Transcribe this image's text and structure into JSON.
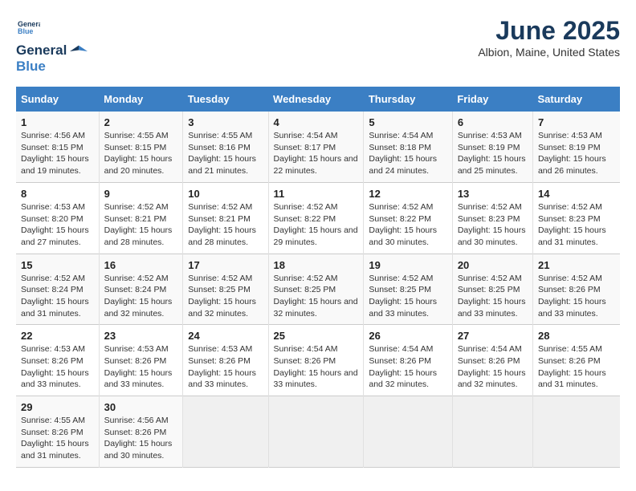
{
  "logo": {
    "line1": "General",
    "line2": "Blue"
  },
  "title": "June 2025",
  "location": "Albion, Maine, United States",
  "days_of_week": [
    "Sunday",
    "Monday",
    "Tuesday",
    "Wednesday",
    "Thursday",
    "Friday",
    "Saturday"
  ],
  "weeks": [
    [
      {
        "day": "1",
        "sunrise": "Sunrise: 4:56 AM",
        "sunset": "Sunset: 8:15 PM",
        "daylight": "Daylight: 15 hours and 19 minutes."
      },
      {
        "day": "2",
        "sunrise": "Sunrise: 4:55 AM",
        "sunset": "Sunset: 8:15 PM",
        "daylight": "Daylight: 15 hours and 20 minutes."
      },
      {
        "day": "3",
        "sunrise": "Sunrise: 4:55 AM",
        "sunset": "Sunset: 8:16 PM",
        "daylight": "Daylight: 15 hours and 21 minutes."
      },
      {
        "day": "4",
        "sunrise": "Sunrise: 4:54 AM",
        "sunset": "Sunset: 8:17 PM",
        "daylight": "Daylight: 15 hours and 22 minutes."
      },
      {
        "day": "5",
        "sunrise": "Sunrise: 4:54 AM",
        "sunset": "Sunset: 8:18 PM",
        "daylight": "Daylight: 15 hours and 24 minutes."
      },
      {
        "day": "6",
        "sunrise": "Sunrise: 4:53 AM",
        "sunset": "Sunset: 8:19 PM",
        "daylight": "Daylight: 15 hours and 25 minutes."
      },
      {
        "day": "7",
        "sunrise": "Sunrise: 4:53 AM",
        "sunset": "Sunset: 8:19 PM",
        "daylight": "Daylight: 15 hours and 26 minutes."
      }
    ],
    [
      {
        "day": "8",
        "sunrise": "Sunrise: 4:53 AM",
        "sunset": "Sunset: 8:20 PM",
        "daylight": "Daylight: 15 hours and 27 minutes."
      },
      {
        "day": "9",
        "sunrise": "Sunrise: 4:52 AM",
        "sunset": "Sunset: 8:21 PM",
        "daylight": "Daylight: 15 hours and 28 minutes."
      },
      {
        "day": "10",
        "sunrise": "Sunrise: 4:52 AM",
        "sunset": "Sunset: 8:21 PM",
        "daylight": "Daylight: 15 hours and 28 minutes."
      },
      {
        "day": "11",
        "sunrise": "Sunrise: 4:52 AM",
        "sunset": "Sunset: 8:22 PM",
        "daylight": "Daylight: 15 hours and 29 minutes."
      },
      {
        "day": "12",
        "sunrise": "Sunrise: 4:52 AM",
        "sunset": "Sunset: 8:22 PM",
        "daylight": "Daylight: 15 hours and 30 minutes."
      },
      {
        "day": "13",
        "sunrise": "Sunrise: 4:52 AM",
        "sunset": "Sunset: 8:23 PM",
        "daylight": "Daylight: 15 hours and 30 minutes."
      },
      {
        "day": "14",
        "sunrise": "Sunrise: 4:52 AM",
        "sunset": "Sunset: 8:23 PM",
        "daylight": "Daylight: 15 hours and 31 minutes."
      }
    ],
    [
      {
        "day": "15",
        "sunrise": "Sunrise: 4:52 AM",
        "sunset": "Sunset: 8:24 PM",
        "daylight": "Daylight: 15 hours and 31 minutes."
      },
      {
        "day": "16",
        "sunrise": "Sunrise: 4:52 AM",
        "sunset": "Sunset: 8:24 PM",
        "daylight": "Daylight: 15 hours and 32 minutes."
      },
      {
        "day": "17",
        "sunrise": "Sunrise: 4:52 AM",
        "sunset": "Sunset: 8:25 PM",
        "daylight": "Daylight: 15 hours and 32 minutes."
      },
      {
        "day": "18",
        "sunrise": "Sunrise: 4:52 AM",
        "sunset": "Sunset: 8:25 PM",
        "daylight": "Daylight: 15 hours and 32 minutes."
      },
      {
        "day": "19",
        "sunrise": "Sunrise: 4:52 AM",
        "sunset": "Sunset: 8:25 PM",
        "daylight": "Daylight: 15 hours and 33 minutes."
      },
      {
        "day": "20",
        "sunrise": "Sunrise: 4:52 AM",
        "sunset": "Sunset: 8:25 PM",
        "daylight": "Daylight: 15 hours and 33 minutes."
      },
      {
        "day": "21",
        "sunrise": "Sunrise: 4:52 AM",
        "sunset": "Sunset: 8:26 PM",
        "daylight": "Daylight: 15 hours and 33 minutes."
      }
    ],
    [
      {
        "day": "22",
        "sunrise": "Sunrise: 4:53 AM",
        "sunset": "Sunset: 8:26 PM",
        "daylight": "Daylight: 15 hours and 33 minutes."
      },
      {
        "day": "23",
        "sunrise": "Sunrise: 4:53 AM",
        "sunset": "Sunset: 8:26 PM",
        "daylight": "Daylight: 15 hours and 33 minutes."
      },
      {
        "day": "24",
        "sunrise": "Sunrise: 4:53 AM",
        "sunset": "Sunset: 8:26 PM",
        "daylight": "Daylight: 15 hours and 33 minutes."
      },
      {
        "day": "25",
        "sunrise": "Sunrise: 4:54 AM",
        "sunset": "Sunset: 8:26 PM",
        "daylight": "Daylight: 15 hours and 33 minutes."
      },
      {
        "day": "26",
        "sunrise": "Sunrise: 4:54 AM",
        "sunset": "Sunset: 8:26 PM",
        "daylight": "Daylight: 15 hours and 32 minutes."
      },
      {
        "day": "27",
        "sunrise": "Sunrise: 4:54 AM",
        "sunset": "Sunset: 8:26 PM",
        "daylight": "Daylight: 15 hours and 32 minutes."
      },
      {
        "day": "28",
        "sunrise": "Sunrise: 4:55 AM",
        "sunset": "Sunset: 8:26 PM",
        "daylight": "Daylight: 15 hours and 31 minutes."
      }
    ],
    [
      {
        "day": "29",
        "sunrise": "Sunrise: 4:55 AM",
        "sunset": "Sunset: 8:26 PM",
        "daylight": "Daylight: 15 hours and 31 minutes."
      },
      {
        "day": "30",
        "sunrise": "Sunrise: 4:56 AM",
        "sunset": "Sunset: 8:26 PM",
        "daylight": "Daylight: 15 hours and 30 minutes."
      },
      null,
      null,
      null,
      null,
      null
    ]
  ]
}
